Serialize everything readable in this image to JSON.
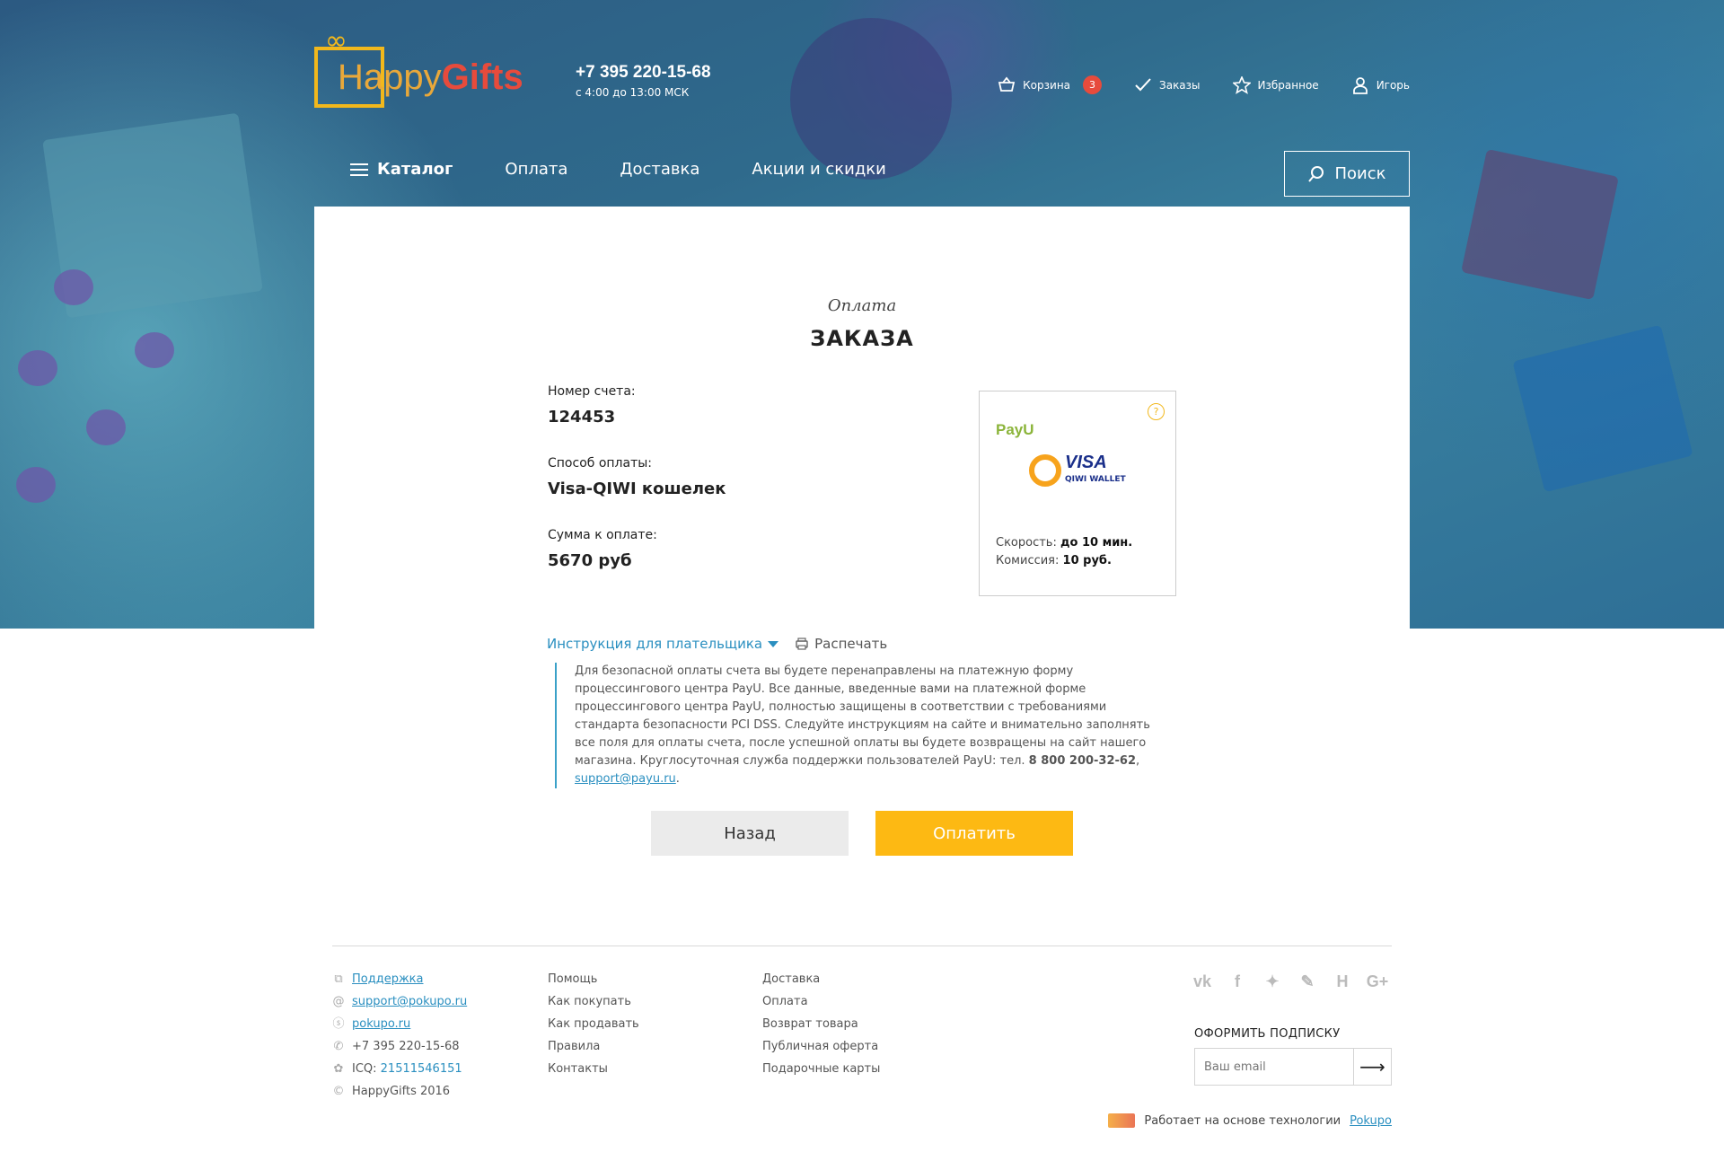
{
  "brand": {
    "name_part1": "Happy",
    "name_part2": "Gifts",
    "accent": "#f2b81c",
    "accent_red": "#e74b3c"
  },
  "header": {
    "phone": "+7 395 220-15-68",
    "hours": "с 4:00 до 13:00 МСК",
    "cart_label": "Корзина",
    "cart_count": "3",
    "orders_label": "Заказы",
    "favorites_label": "Избранное",
    "user_label": "Игорь"
  },
  "nav": {
    "catalog": "Каталог",
    "items": [
      "Оплата",
      "Доставка",
      "Акции и скидки"
    ],
    "search": "Поиск"
  },
  "page": {
    "subtitle": "Оплата",
    "title": "ЗАКАЗА"
  },
  "order": {
    "number_label": "Номер счета:",
    "number": "124453",
    "method_label": "Способ оплаты:",
    "method": "Visa-QIWI кошелек",
    "sum_label": "Сумма к оплате:",
    "sum": "5670 руб"
  },
  "paybox": {
    "help": "?",
    "provider": "PayU",
    "visa": "VISA",
    "wallet": "QIWI WALLET",
    "speed_label": "Скорость:",
    "speed": "до 10 мин.",
    "fee_label": "Комиссия:",
    "fee": "10 руб."
  },
  "instructions": {
    "toggle": "Инструкция для плательщика",
    "print": "Распечать",
    "text": "Для безопасной оплаты счета вы будете перенаправлены на платежную форму процессингового центра PayU. Все данные, введенные вами на платежной форме процессингового центра PayU, полностью защищены в соответствии с требованиями стандарта безопасности PCI DSS. Следуйте инструкциям на сайте и внимательно заполнять все поля для оплаты счета, после успешной оплаты вы будете возвращены на сайт нашего магазина. Круглосуточная служба поддержки пользователей PayU: тел. ",
    "phone": "8 800 200-32-62",
    "sep": ", ",
    "email": "support@payu.ru",
    "end": "."
  },
  "buttons": {
    "back": "Назад",
    "pay": "Оплатить"
  },
  "footer": {
    "contacts": {
      "support": "Поддержка",
      "email": "support@pokupo.ru",
      "skype": "pokupo.ru",
      "phone": "+7 395 220-15-68",
      "icq_label": "ICQ: ",
      "icq": "21511546151",
      "copyright": "HappyGifts 2016"
    },
    "col2": [
      "Помощь",
      "Как покупать",
      "Как продавать",
      "Правила",
      "Контакты"
    ],
    "col3": [
      "Доставка",
      "Оплата",
      "Возврат товара",
      "Публичная оферта",
      "Подарочные карты"
    ],
    "social": [
      "vk",
      "f",
      "twitter",
      "livejournal",
      "H",
      "G+"
    ],
    "subscribe_title": "ОФОРМИТЬ ПОДПИСКУ",
    "email_placeholder": "Ваш email",
    "powered_text": "Работает на основе технологии",
    "powered_link": "Pokupo"
  }
}
